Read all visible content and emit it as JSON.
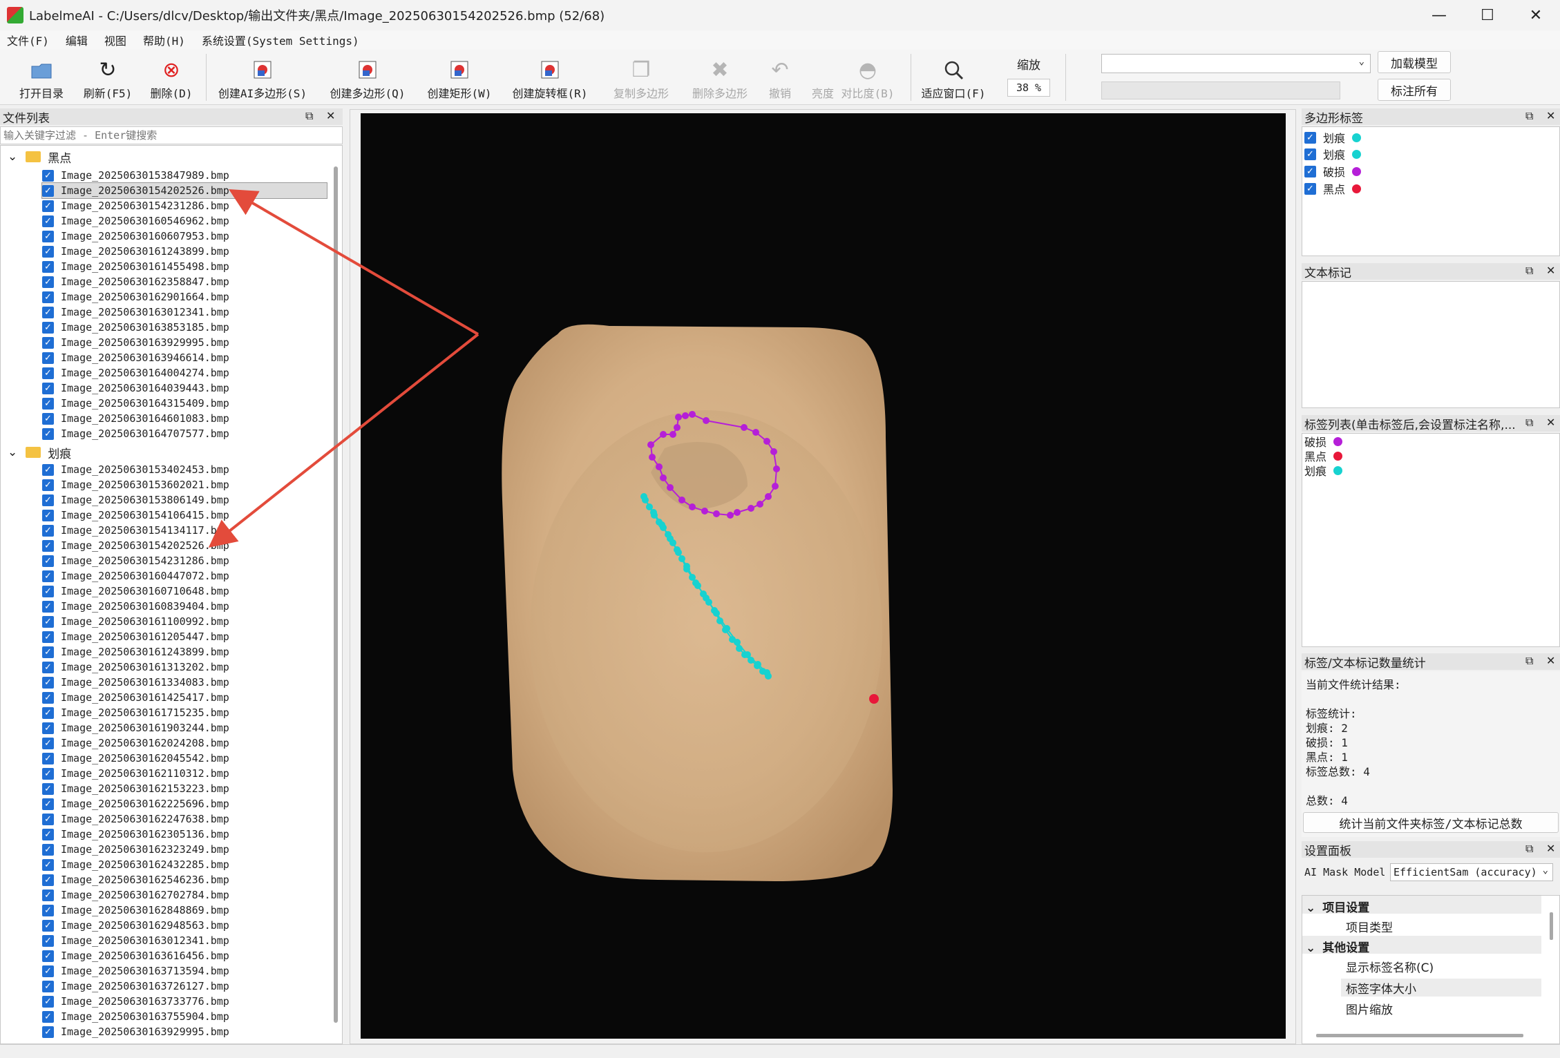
{
  "window": {
    "title": "LabelmeAI - C:/Users/dlcv/Desktop/输出文件夹/黑点/Image_20250630154202526.bmp (52/68)",
    "minimize": "—",
    "maximize": "☐",
    "close": "✕"
  },
  "menu": [
    "文件(F)",
    "编辑",
    "视图",
    "帮助(H)",
    "系统设置(System Settings)"
  ],
  "toolbar": {
    "open_dir": "打开目录",
    "refresh": "刷新(F5)",
    "delete": "删除(D)",
    "create_ai_polygon": "创建AI多边形(S)",
    "create_polygon": "创建多边形(Q)",
    "create_rect": "创建矩形(W)",
    "create_rotated_rect": "创建旋转框(R)",
    "copy_polygon": "复制多边形",
    "delete_polygon": "删除多边形",
    "undo": "撤销",
    "brightness": "亮度",
    "contrast": "对比度(B)",
    "fit_window": "适应窗口(F)",
    "zoom_label": "缩放",
    "zoom_value": "38 %",
    "load_model": "加载模型",
    "label_all": "标注所有",
    "model_select": ""
  },
  "file_panel": {
    "title": "文件列表",
    "filter_placeholder": "输入关键字过滤 - Enter键搜索",
    "folders": [
      {
        "name": "黑点",
        "files": [
          "Image_20250630153847989.bmp",
          "Image_20250630154202526.bmp",
          "Image_20250630154231286.bmp",
          "Image_20250630160546962.bmp",
          "Image_20250630160607953.bmp",
          "Image_20250630161243899.bmp",
          "Image_20250630161455498.bmp",
          "Image_20250630162358847.bmp",
          "Image_20250630162901664.bmp",
          "Image_20250630163012341.bmp",
          "Image_20250630163853185.bmp",
          "Image_20250630163929995.bmp",
          "Image_20250630163946614.bmp",
          "Image_20250630164004274.bmp",
          "Image_20250630164039443.bmp",
          "Image_20250630164315409.bmp",
          "Image_20250630164601083.bmp",
          "Image_20250630164707577.bmp"
        ]
      },
      {
        "name": "划痕",
        "files": [
          "Image_20250630153402453.bmp",
          "Image_20250630153602021.bmp",
          "Image_20250630153806149.bmp",
          "Image_20250630154106415.bmp",
          "Image_20250630154134117.bmp",
          "Image_20250630154202526.bmp",
          "Image_20250630154231286.bmp",
          "Image_20250630160447072.bmp",
          "Image_20250630160710648.bmp",
          "Image_20250630160839404.bmp",
          "Image_20250630161100992.bmp",
          "Image_20250630161205447.bmp",
          "Image_20250630161243899.bmp",
          "Image_20250630161313202.bmp",
          "Image_20250630161334083.bmp",
          "Image_20250630161425417.bmp",
          "Image_20250630161715235.bmp",
          "Image_20250630161903244.bmp",
          "Image_20250630162024208.bmp",
          "Image_20250630162045542.bmp",
          "Image_20250630162110312.bmp",
          "Image_20250630162153223.bmp",
          "Image_20250630162225696.bmp",
          "Image_20250630162247638.bmp",
          "Image_20250630162305136.bmp",
          "Image_20250630162323249.bmp",
          "Image_20250630162432285.bmp",
          "Image_20250630162546236.bmp",
          "Image_20250630162702784.bmp",
          "Image_20250630162848869.bmp",
          "Image_20250630162948563.bmp",
          "Image_20250630163012341.bmp",
          "Image_20250630163616456.bmp",
          "Image_20250630163713594.bmp",
          "Image_20250630163726127.bmp",
          "Image_20250630163733776.bmp",
          "Image_20250630163755904.bmp",
          "Image_20250630163929995.bmp"
        ]
      }
    ]
  },
  "polygon_labels": {
    "title": "多边形标签",
    "items": [
      {
        "label": "划痕",
        "color": "#17d2d0"
      },
      {
        "label": "划痕",
        "color": "#17d2d0"
      },
      {
        "label": "破损",
        "color": "#b51fd8"
      },
      {
        "label": "黑点",
        "color": "#e8183a"
      }
    ]
  },
  "text_marks": {
    "title": "文本标记"
  },
  "label_list": {
    "title": "标签列表(单击标签后,会设置标注名称,...",
    "items": [
      {
        "label": "破损",
        "color": "#b51fd8"
      },
      {
        "label": "黑点",
        "color": "#e8183a"
      },
      {
        "label": "划痕",
        "color": "#17d2d0"
      }
    ]
  },
  "stats": {
    "title": "标签/文本标记数量统计",
    "lines": [
      "当前文件统计结果:",
      "",
      "标签统计:",
      "划痕: 2",
      "破损: 1",
      "黑点: 1",
      "标签总数: 4",
      "",
      "总数: 4"
    ],
    "button": "统计当前文件夹标签/文本标记总数"
  },
  "settings": {
    "title": "设置面板",
    "model_label": "AI Mask Model",
    "model_value": "EfficientSam (accuracy)",
    "tree": [
      {
        "text": "项目设置",
        "kind": "group"
      },
      {
        "text": "项目类型",
        "kind": "item"
      },
      {
        "text": "其他设置",
        "kind": "group"
      },
      {
        "text": "显示标签名称(C)",
        "kind": "item"
      },
      {
        "text": "标签字体大小",
        "kind": "item"
      },
      {
        "text": "图片缩放",
        "kind": "item"
      }
    ]
  },
  "dock_float": "⧉",
  "dock_close": "✕"
}
